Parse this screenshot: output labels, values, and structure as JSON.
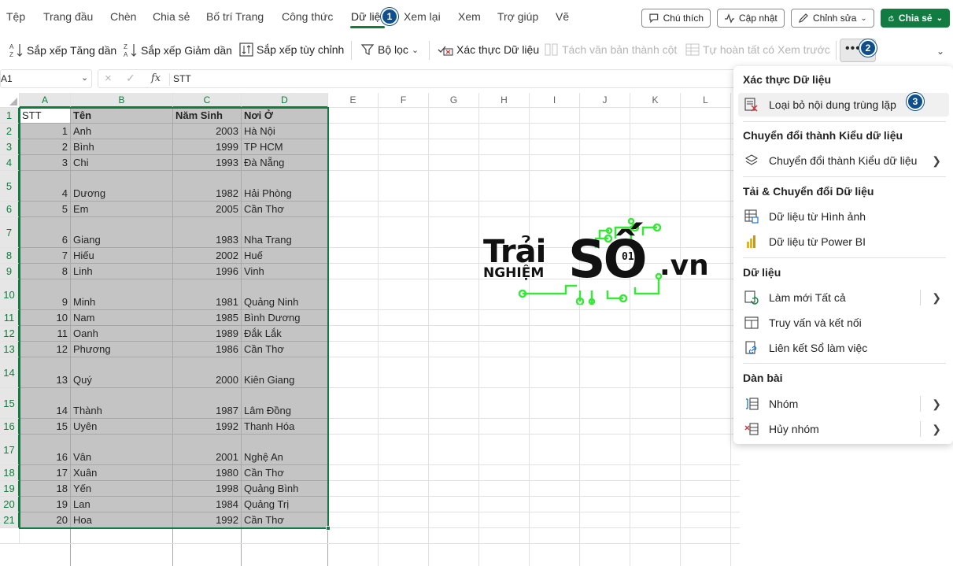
{
  "menu": {
    "tabs": [
      "Tệp",
      "Trang đầu",
      "Chèn",
      "Chia sẻ",
      "Bố trí Trang",
      "Công thức",
      "Dữ liệu",
      "Xem lại",
      "Xem",
      "Trợ giúp",
      "Vẽ"
    ],
    "active_tab": "Dữ liệu",
    "comments_label": "Chú thích",
    "catchup_label": "Cập nhật",
    "editing_label": "Chỉnh sửa",
    "share_label": "Chia sẻ"
  },
  "badges": {
    "b1": "1",
    "b2": "2",
    "b3": "3"
  },
  "ribbon": {
    "sort_asc": "Sắp xếp Tăng dần",
    "sort_desc": "Sắp xếp Giảm dần",
    "custom_sort": "Sắp xếp tùy chỉnh",
    "filter": "Bộ lọc",
    "data_validation": "Xác thực Dữ liệu",
    "text_to_columns": "Tách văn bản thành cột",
    "flash_fill": "Tự hoàn tất có Xem trước"
  },
  "formula_bar": {
    "name_box": "A1",
    "fx": "fx",
    "value": "STT"
  },
  "columns": [
    "A",
    "B",
    "C",
    "D",
    "E",
    "F",
    "G",
    "H",
    "I",
    "J",
    "K",
    "L"
  ],
  "table": {
    "headers": [
      "STT",
      "Tên",
      "Năm Sinh",
      "Nơi Ở"
    ],
    "rows": [
      [
        "1",
        "Anh",
        "2003",
        "Hà Nội"
      ],
      [
        "2",
        "Bình",
        "1999",
        "TP HCM"
      ],
      [
        "3",
        "Chi",
        "1993",
        "Đà Nẵng"
      ],
      [
        "4",
        "Dương",
        "1982",
        "Hải Phòng"
      ],
      [
        "5",
        "Em",
        "2005",
        "Cần Thơ"
      ],
      [
        "6",
        "Giang",
        "1983",
        "Nha Trang"
      ],
      [
        "7",
        "Hiếu",
        "2002",
        "Huế"
      ],
      [
        "8",
        "Linh",
        "1996",
        "Vinh"
      ],
      [
        "9",
        "Minh",
        "1981",
        "Quảng Ninh"
      ],
      [
        "10",
        "Nam",
        "1985",
        "Bình Dương"
      ],
      [
        "11",
        "Oanh",
        "1989",
        "Đắk Lắk"
      ],
      [
        "12",
        "Phương",
        "1986",
        "Cần Thơ"
      ],
      [
        "13",
        "Quý",
        "2000",
        "Kiên Giang"
      ],
      [
        "14",
        "Thành",
        "1987",
        "Lâm Đồng"
      ],
      [
        "15",
        "Uyên",
        "1992",
        "Thanh Hóa"
      ],
      [
        "16",
        "Vân",
        "2001",
        "Nghệ An"
      ],
      [
        "17",
        "Xuân",
        "1980",
        "Cần Thơ"
      ],
      [
        "18",
        "Yến",
        "1998",
        "Quảng Bình"
      ],
      [
        "19",
        "Lan",
        "1984",
        "Quảng Trị"
      ],
      [
        "20",
        "Hoa",
        "1992",
        "Cần Thơ"
      ]
    ]
  },
  "row_numbers": [
    "1",
    "2",
    "3",
    "4",
    "5",
    "6",
    "7",
    "8",
    "9",
    "10",
    "11",
    "12",
    "13",
    "14",
    "15",
    "16",
    "17",
    "18",
    "19",
    "20",
    "21"
  ],
  "watermark": {
    "line1": "Trải",
    "line2": "NGHIỆM",
    "big": "SỐ",
    "tld": ".vn",
    "small": "01"
  },
  "dropdown": {
    "sec1": "Xác thực Dữ liệu",
    "remove_duplicates": "Loại bỏ nội dung trùng lặp",
    "sec2": "Chuyển đổi thành Kiểu dữ liệu",
    "convert_types": "Chuyển đổi thành Kiểu dữ liệu",
    "sec3": "Tải & Chuyển đổi Dữ liệu",
    "from_picture": "Dữ liệu từ Hình ảnh",
    "from_powerbi": "Dữ liệu từ Power BI",
    "sec4": "Dữ liệu",
    "refresh_all": "Làm mới Tất cả",
    "queries": "Truy vấn và kết nối",
    "workbook_links": "Liên kết Sổ làm việc",
    "sec5": "Dàn bài",
    "group": "Nhóm",
    "ungroup": "Hủy nhóm"
  },
  "colors": {
    "accent": "#107c41",
    "badge": "#0e4f8c",
    "selection": "#c4c4c4",
    "logo_green": "#39e639"
  }
}
